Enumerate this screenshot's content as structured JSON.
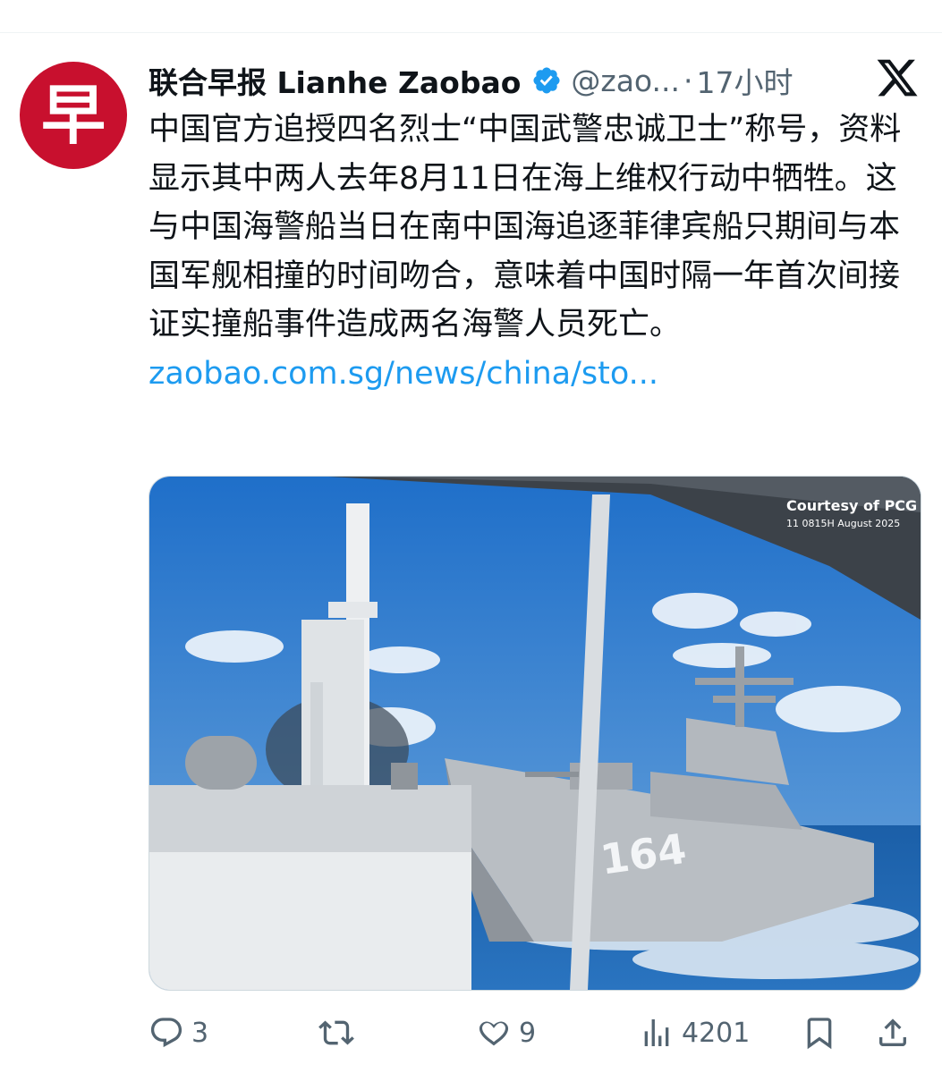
{
  "author": {
    "avatar_glyph": "早",
    "name": "联合早报 Lianhe Zaobao",
    "handle": "@zao...",
    "separator": "·",
    "time": "17小时",
    "brand_color": "#c8102e",
    "verified_color": "#1d9bf0"
  },
  "tweet": {
    "text": "中国官方追授四名烈士“中国武警忠诚卫士”称号，资料显示其中两人去年8月11日在海上维权行动中牺牲。这与中国海警船当日在南中国海追逐菲律宾船只期间与本国军舰相撞的时间吻合，意味着中国时隔一年首次间接证实撞船事件造成两名海警人员死亡。",
    "link": "zaobao.com.sg/news/china/sto..."
  },
  "media": {
    "watermark_line1": "Courtesy of PCG",
    "watermark_line2": "11 0815H August 2025",
    "hull_number": "164"
  },
  "actions": {
    "replies": "3",
    "reposts": "",
    "likes": "9",
    "views": "4201"
  },
  "icons": {
    "verified": "verified-badge-icon",
    "x": "x-logo-icon",
    "reply": "reply-icon",
    "repost": "repost-icon",
    "like": "like-icon",
    "views": "views-icon",
    "bookmark": "bookmark-icon",
    "share": "share-icon"
  }
}
